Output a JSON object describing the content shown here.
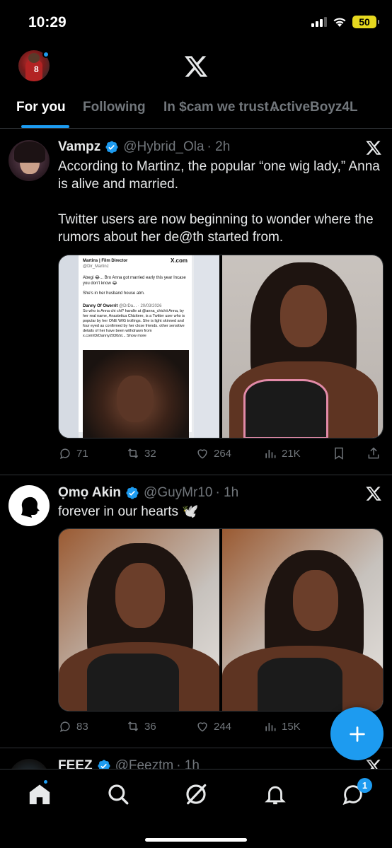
{
  "status_bar": {
    "time": "10:29",
    "battery": "50"
  },
  "tabs": [
    {
      "label": "For you",
      "active": true
    },
    {
      "label": "Following",
      "active": false
    },
    {
      "label": "In $cam we trust ...",
      "active": false
    },
    {
      "label": "ActiveBoyz4L",
      "active": false
    }
  ],
  "posts": [
    {
      "name": "Vampz",
      "handle": "@Hybrid_Ola",
      "time": "· 2h",
      "text": "According to Martinz, the popular “one wig lady,” Anna is alive and married.\n\nTwitter users are now beginning to wonder where the rumors about her de@th started from.",
      "embedded": {
        "author": "Martins | Film Director",
        "author_handle": "@Dir_Martinz",
        "site": "X.com",
        "line1": "Abegi 😂... Bro Anna got married early this year Incase you don't know 😂",
        "line2": "She's in her husband house atm.",
        "quoted_author": "Danny Of Owerrit",
        "quoted_handle": "@DrDa... · 20/03/2026",
        "quoted_text": "So who is Anna chi chi? handle at @anna_chichii Anna, by her real name, Anastetica Chizitere, is a Twitter user who is popular by her ONE WIG trollings. She is light skinned and four eyed as confirmed by her close friends. other sensitive details of her have been withdrawn from x.com/DrDanny2030/st... Show more"
      },
      "replies": "71",
      "reposts": "32",
      "likes": "264",
      "views": "21K"
    },
    {
      "name": "Ọmọ Akin",
      "handle": "@GuyMr10",
      "time": "· 1h",
      "text": "forever in our hearts 🕊️",
      "replies": "83",
      "reposts": "36",
      "likes": "244",
      "views": "15K"
    },
    {
      "name": "FEEZ",
      "handle": "@Feeztm",
      "time": "· 1h"
    }
  ],
  "nav": {
    "messages_badge": "1"
  },
  "colors": {
    "accent": "#1d9bf0",
    "background": "#000000",
    "muted": "#71767b",
    "text": "#e7e9ea",
    "divider": "#2f3336"
  }
}
